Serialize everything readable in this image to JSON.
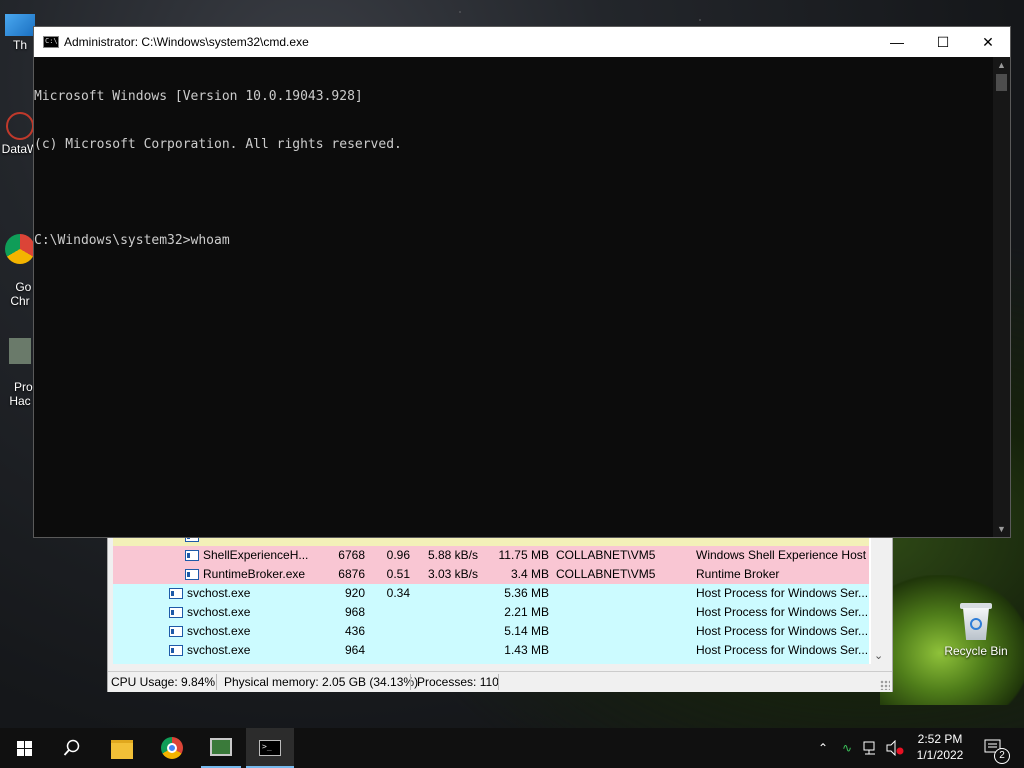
{
  "desktop": {
    "icons": [
      {
        "label": "Th"
      },
      {
        "label": "DataW"
      },
      {
        "label": "Go\nChr"
      },
      {
        "label": "Pro\nHac"
      }
    ],
    "recycle_bin_label": "Recycle Bin"
  },
  "cmd": {
    "title": "Administrator: C:\\Windows\\system32\\cmd.exe",
    "lines": [
      "Microsoft Windows [Version 10.0.19043.928]",
      "(c) Microsoft Corporation. All rights reserved.",
      "",
      "C:\\Windows\\system32>whoam"
    ],
    "minimize_glyph": "—",
    "maximize_glyph": "☐",
    "close_glyph": "✕"
  },
  "process_hacker": {
    "rows": [
      {
        "name": "",
        "pid": "",
        "cpu": "",
        "io": "",
        "mem": "",
        "user": "",
        "desc": "",
        "color": "yellow",
        "indent": 2
      },
      {
        "name": "ShellExperienceH...",
        "pid": "6768",
        "cpu": "0.96",
        "io": "5.88 kB/s",
        "mem": "11.75 MB",
        "user": "COLLABNET\\VM5",
        "desc": "Windows Shell Experience Host",
        "color": "pink",
        "indent": 2
      },
      {
        "name": "RuntimeBroker.exe",
        "pid": "6876",
        "cpu": "0.51",
        "io": "3.03 kB/s",
        "mem": "3.4 MB",
        "user": "COLLABNET\\VM5",
        "desc": "Runtime Broker",
        "color": "pink",
        "indent": 2
      },
      {
        "name": "svchost.exe",
        "pid": "920",
        "cpu": "0.34",
        "io": "",
        "mem": "5.36 MB",
        "user": "",
        "desc": "Host Process for Windows Ser...",
        "color": "cyan",
        "indent": 1
      },
      {
        "name": "svchost.exe",
        "pid": "968",
        "cpu": "",
        "io": "",
        "mem": "2.21 MB",
        "user": "",
        "desc": "Host Process for Windows Ser...",
        "color": "cyan",
        "indent": 1
      },
      {
        "name": "svchost.exe",
        "pid": "436",
        "cpu": "",
        "io": "",
        "mem": "5.14 MB",
        "user": "",
        "desc": "Host Process for Windows Ser...",
        "color": "cyan",
        "indent": 1
      },
      {
        "name": "svchost.exe",
        "pid": "964",
        "cpu": "",
        "io": "",
        "mem": "1.43 MB",
        "user": "",
        "desc": "Host Process for Windows Ser...",
        "color": "cyan",
        "indent": 1
      },
      {
        "name": "",
        "pid": "",
        "cpu": "",
        "io": "",
        "mem": "",
        "user": "",
        "desc": "",
        "color": "cyan",
        "indent": 1
      }
    ],
    "status": {
      "cpu": "CPU Usage: 9.84%",
      "memory": "Physical memory: 2.05 GB (34.13%)",
      "processes": "Processes: 110"
    }
  },
  "taskbar": {
    "items": [
      "start-button",
      "search-button",
      "file-explorer",
      "chrome",
      "process-hacker",
      "cmd"
    ],
    "time": "2:52 PM",
    "date": "1/1/2022",
    "notification_count": "2"
  },
  "colors": {
    "cmd_bg": "#0c0c0c",
    "cmd_fg": "#cccccc",
    "pink_row": "#f9c6d3",
    "cyan_row": "#ccfbff",
    "taskbar_bg": "#101010",
    "accent": "#76b9ed"
  }
}
